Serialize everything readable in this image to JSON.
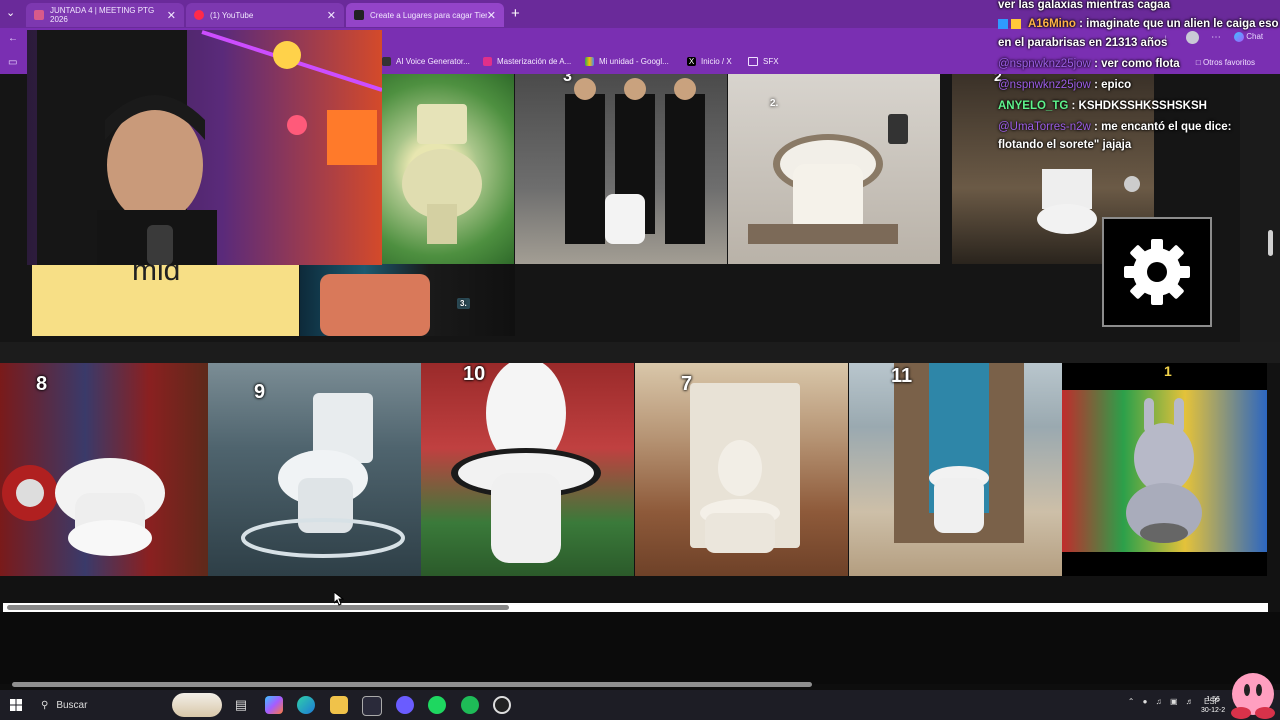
{
  "browser": {
    "tabs": [
      {
        "label": "JUNTADA 4 | MEETING PTG 2026"
      },
      {
        "label": "(1) YouTube"
      },
      {
        "label": "Create a Lugares para cagar Tier L"
      }
    ],
    "bookmarks": [
      {
        "label": "AI Voice Generator..."
      },
      {
        "label": "Masterización de A..."
      },
      {
        "label": "Mi unidad - Googl..."
      },
      {
        "label": "Inicio / X"
      },
      {
        "label": "SFX"
      }
    ],
    "other_favorites": "Otros favoritos",
    "chat_button": "Chat"
  },
  "tierlist": {
    "upper_tiles": [
      {
        "num": ""
      },
      {
        "num": "3"
      },
      {
        "num": "2."
      },
      {
        "num": "2"
      }
    ],
    "partial_card_text": "mid",
    "small_tile_num": "3.",
    "row_tiles": [
      {
        "num": "8",
        "icon": "superheroes-toilet-image"
      },
      {
        "num": "9",
        "icon": "ocean-toilet-image"
      },
      {
        "num": "10",
        "icon": "stadium-toilet-image"
      },
      {
        "num": "7",
        "icon": "desert-toilet-image"
      },
      {
        "num": "11",
        "icon": "beach-toilet-image"
      },
      {
        "num": "1",
        "icon": "cartoon-rabbit-toilet-image"
      }
    ],
    "settings_icon": "gear-icon",
    "scroll_position": 0.4
  },
  "chat": {
    "messages": [
      {
        "user": "",
        "text": "ver las galaxias mientras cagaa",
        "color": "#ffffff"
      },
      {
        "user": "A16Mino",
        "text": ": imaginate que un alien le caiga eso",
        "color": "#ffb347"
      },
      {
        "user": "",
        "text": "en el parabrisas en 21313 años",
        "color": "#ffffff"
      },
      {
        "user": "@nspnwknz25jow",
        "text": ": ver como flota",
        "color": "#9b5de5"
      },
      {
        "user": "@nspnwknz25jow",
        "text": ": epico",
        "color": "#9b5de5"
      },
      {
        "user": "ANYELO_TG",
        "text": ": KSHDKSSHKSSHSKSH",
        "color": "#5ef38c"
      },
      {
        "user": "@UmaTorres-n2w",
        "text": ": me encantó el que dice:",
        "color": "#9b5de5"
      },
      {
        "user": "",
        "text": "flotando el sorete\" jajaja",
        "color": "#ffffff"
      }
    ]
  },
  "taskbar": {
    "search_label": "Buscar",
    "tray_lang": "ESP",
    "time": "1:56",
    "date": "30-12-2"
  }
}
